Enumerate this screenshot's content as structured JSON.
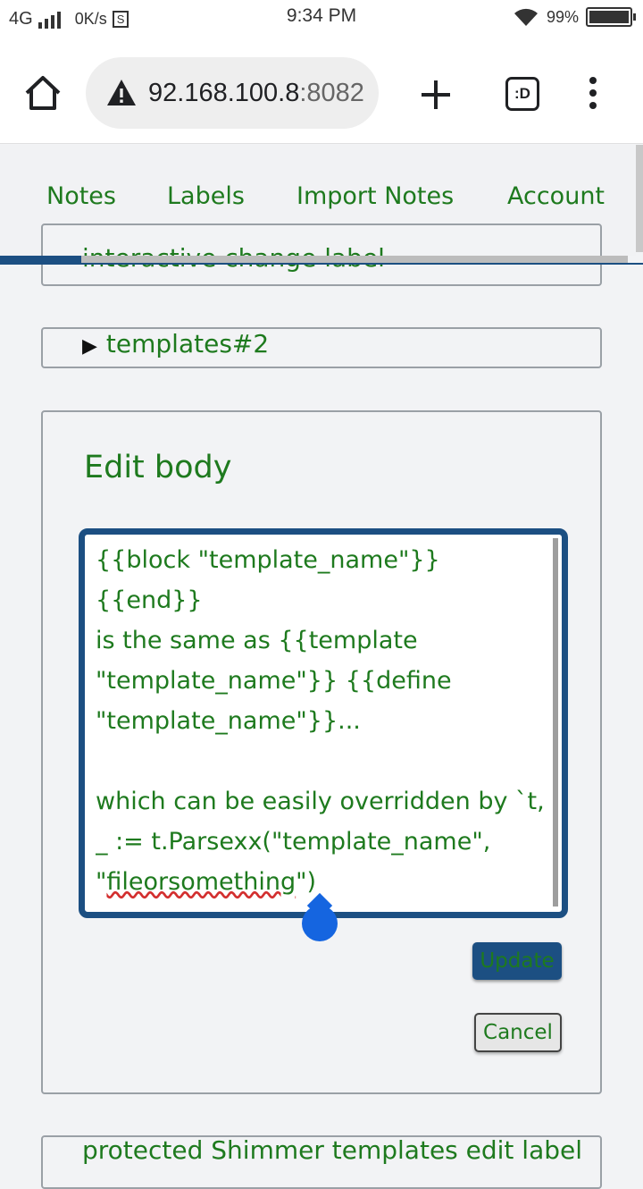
{
  "status_bar": {
    "network": "4G",
    "speed": "0K/s",
    "s_badge": "S",
    "time": "9:34 PM",
    "battery_percent": "99%",
    "battery_level": 0.99
  },
  "browser": {
    "url_host": "92.168.100.8",
    "url_port": ":8082",
    "tabs_label": ":D"
  },
  "nav": {
    "items": [
      "Notes",
      "Labels",
      "Import Notes",
      "Account"
    ]
  },
  "scroll_progress": 0.13,
  "sections": {
    "partial_label": "interactive change label",
    "templates_label": "templates#2",
    "bottom_partial": "protected Shimmer templates edit label"
  },
  "edit": {
    "title": "Edit body",
    "body_lines": [
      "{{block \"template_name\"}}",
      "{{end}}",
      "is the same as {{template",
      "\"template_name\"}} {{define",
      "\"template_name\"}}...",
      "",
      "which can be easily overridden by `t,",
      "_ := t.Parsexx(\"template_name\","
    ],
    "last_line_prefix": "\"",
    "last_line_word": "fileorsomething",
    "last_line_suffix": "\")",
    "update_label": "Update",
    "cancel_label": "Cancel"
  }
}
